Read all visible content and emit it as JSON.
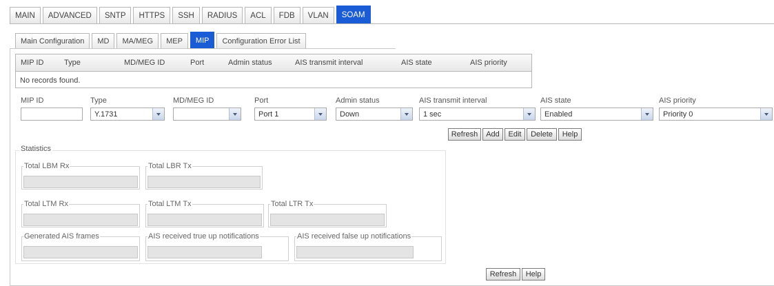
{
  "top_tabs": [
    "MAIN",
    "ADVANCED",
    "SNTP",
    "HTTPS",
    "SSH",
    "RADIUS",
    "ACL",
    "FDB",
    "VLAN",
    "SOAM"
  ],
  "top_active": "SOAM",
  "sub_tabs": [
    "Main Configuration",
    "MD",
    "MA/MEG",
    "MEP",
    "MIP",
    "Configuration Error List"
  ],
  "sub_active": "MIP",
  "records": {
    "columns": [
      "MIP ID",
      "Type",
      "MD/MEG ID",
      "Port",
      "Admin status",
      "AIS transmit interval",
      "AIS state",
      "AIS priority"
    ],
    "empty_text": "No records found."
  },
  "form": {
    "mip_id": {
      "label": "MIP ID",
      "value": ""
    },
    "type": {
      "label": "Type",
      "value": "Y.1731"
    },
    "md_meg_id": {
      "label": "MD/MEG ID",
      "value": ""
    },
    "port": {
      "label": "Port",
      "value": "Port 1"
    },
    "admin_status": {
      "label": "Admin status",
      "value": "Down"
    },
    "ais_interval": {
      "label": "AIS transmit interval",
      "value": "1 sec"
    },
    "ais_state": {
      "label": "AIS state",
      "value": "Enabled"
    },
    "ais_priority": {
      "label": "AIS priority",
      "value": "Priority 0"
    }
  },
  "buttons": {
    "refresh": "Refresh",
    "add": "Add",
    "edit": "Edit",
    "delete": "Delete",
    "help": "Help"
  },
  "statistics": {
    "legend": "Statistics",
    "total_lbm_rx": "Total LBM Rx",
    "total_lbr_tx": "Total LBR Tx",
    "total_ltm_rx": "Total LTM Rx",
    "total_ltm_tx": "Total LTM Tx",
    "total_ltr_tx": "Total LTR Tx",
    "generated_ais": "Generated AIS frames",
    "ais_true_up": "AIS received true up notifications",
    "ais_false_up": "AIS received false up notifications"
  },
  "colors": {
    "active_tab": "#1a5bd6"
  }
}
